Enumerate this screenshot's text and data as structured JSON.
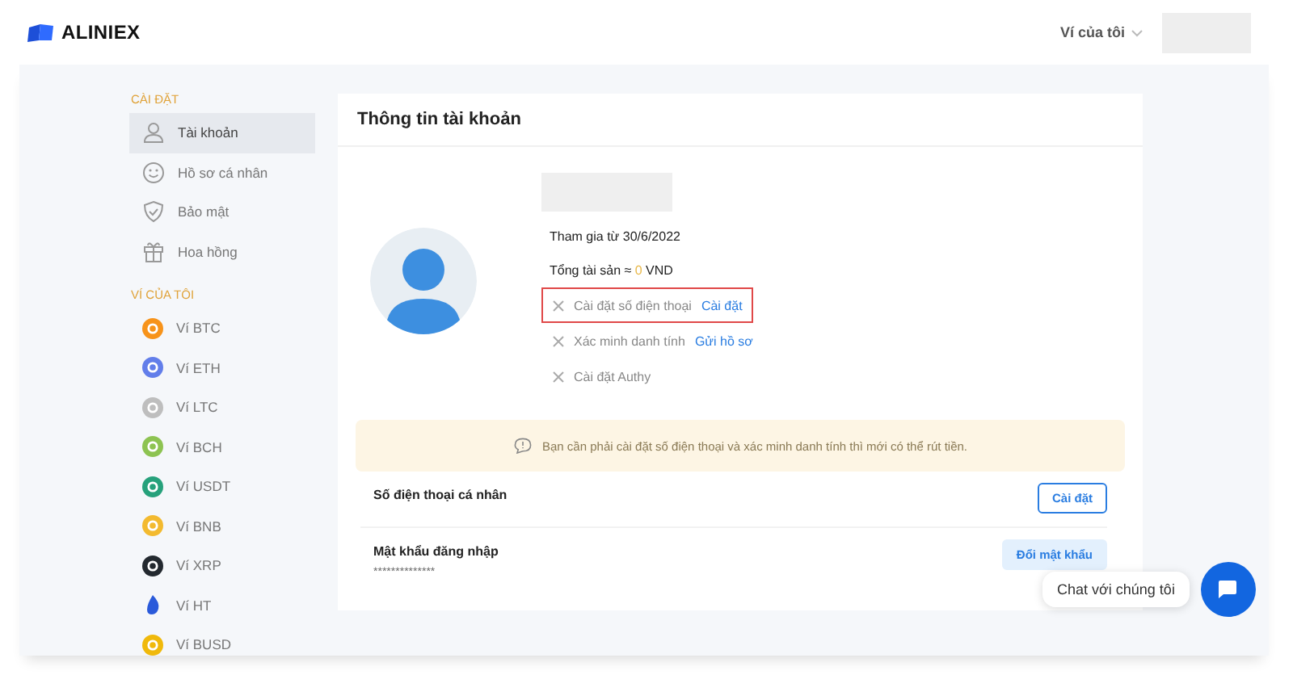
{
  "header": {
    "brand": "ALINIEX",
    "wallet_menu": "Ví của tôi"
  },
  "sidebar": {
    "sections": [
      {
        "title": "CÀI ĐẶT",
        "items": [
          {
            "label": "Tài khoản",
            "kind": "user",
            "selected": true
          },
          {
            "label": "Hồ sơ cá nhân",
            "kind": "smile",
            "selected": false
          },
          {
            "label": "Bảo mật",
            "kind": "shield",
            "selected": false
          },
          {
            "label": "Hoa hồng",
            "kind": "gift",
            "selected": false
          }
        ]
      },
      {
        "title": "VÍ CỦA TÔI",
        "items": [
          {
            "label": "Ví BTC",
            "kind": "coin",
            "color": "#f7931a",
            "selected": false
          },
          {
            "label": "Ví ETH",
            "kind": "coin",
            "color": "#627eea",
            "selected": false
          },
          {
            "label": "Ví LTC",
            "kind": "coin",
            "color": "#bebebe",
            "selected": false
          },
          {
            "label": "Ví BCH",
            "kind": "coin",
            "color": "#8dc351",
            "selected": false
          },
          {
            "label": "Ví USDT",
            "kind": "coin",
            "color": "#26a17b",
            "selected": false
          },
          {
            "label": "Ví BNB",
            "kind": "coin",
            "color": "#f3ba2f",
            "selected": false
          },
          {
            "label": "Ví XRP",
            "kind": "coin",
            "color": "#23292f",
            "selected": false
          },
          {
            "label": "Ví HT",
            "kind": "flame",
            "color": "#2a5ada",
            "selected": false
          },
          {
            "label": "Ví BUSD",
            "kind": "coin",
            "color": "#f0b90b",
            "selected": false
          }
        ]
      }
    ]
  },
  "account": {
    "title": "Thông tin tài khoản",
    "joined": "Tham gia từ 30/6/2022",
    "assets_label": "Tổng tài sản ≈ ",
    "assets_value": "0",
    "assets_unit": "VND",
    "checklist": [
      {
        "label": "Cài đặt số điện thoại",
        "link": "Cài đặt",
        "done": false,
        "highlighted": true
      },
      {
        "label": "Xác minh danh tính",
        "link": "Gửi hồ sơ",
        "done": false,
        "highlighted": false
      },
      {
        "label": "Cài đặt Authy",
        "done": false,
        "highlighted": false
      }
    ],
    "notice": "Bạn cần phải cài đặt số điện thoại và xác minh danh tính thì mới có thể rút tiền.",
    "settings": [
      {
        "label": "Số điện thoại cá nhân",
        "button": "Cài đặt",
        "kind": "outline"
      },
      {
        "label": "Mật khẩu đăng nhập",
        "value": "**************",
        "button": "Đổi mật khẩu",
        "kind": "soft"
      }
    ]
  },
  "chat": {
    "label": "Chat với chúng tôi"
  }
}
